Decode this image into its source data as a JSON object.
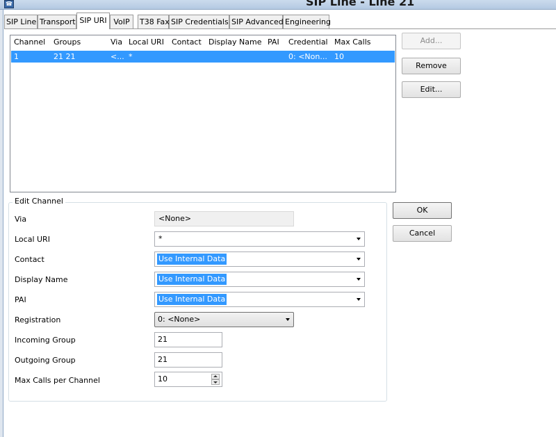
{
  "window": {
    "title": "SIP Line - Line 21",
    "icon": "app-icon"
  },
  "tabs": [
    {
      "label": "SIP Line"
    },
    {
      "label": "Transport"
    },
    {
      "label": "SIP URI"
    },
    {
      "label": "VoIP"
    },
    {
      "label": "T38 Fax"
    },
    {
      "label": "SIP Credentials"
    },
    {
      "label": "SIP Advanced"
    },
    {
      "label": "Engineering"
    }
  ],
  "active_tab": "SIP URI",
  "uri_table": {
    "columns": [
      "Channel",
      "Groups",
      "Via",
      "Local URI",
      "Contact",
      "Display Name",
      "PAI",
      "Credential",
      "Max Calls"
    ],
    "rows": [
      {
        "channel": "1",
        "groups": "21  21",
        "via": "<...",
        "local_uri": "*",
        "contact": "",
        "display_name": "",
        "pai": "",
        "credential": "0: <Non...",
        "max_calls": "10",
        "selected": true
      }
    ]
  },
  "side_buttons": {
    "add": "Add...",
    "remove": "Remove",
    "edit": "Edit..."
  },
  "edit_channel": {
    "legend": "Edit Channel",
    "via": {
      "label": "Via",
      "value": "<None>"
    },
    "local_uri": {
      "label": "Local URI",
      "value": "*"
    },
    "contact": {
      "label": "Contact",
      "value": "Use Internal Data"
    },
    "display_name": {
      "label": "Display Name",
      "value": "Use Internal Data"
    },
    "pai": {
      "label": "PAI",
      "value": "Use Internal Data"
    },
    "registration": {
      "label": "Registration",
      "value": "0: <None>"
    },
    "incoming_group": {
      "label": "Incoming Group",
      "value": "21"
    },
    "outgoing_group": {
      "label": "Outgoing Group",
      "value": "21"
    },
    "max_calls": {
      "label": "Max Calls per Channel",
      "value": "10"
    }
  },
  "dialog_buttons": {
    "ok": "OK",
    "cancel": "Cancel"
  },
  "colors": {
    "selection": "#3399ff",
    "titlebar": "#b4c9e2"
  }
}
